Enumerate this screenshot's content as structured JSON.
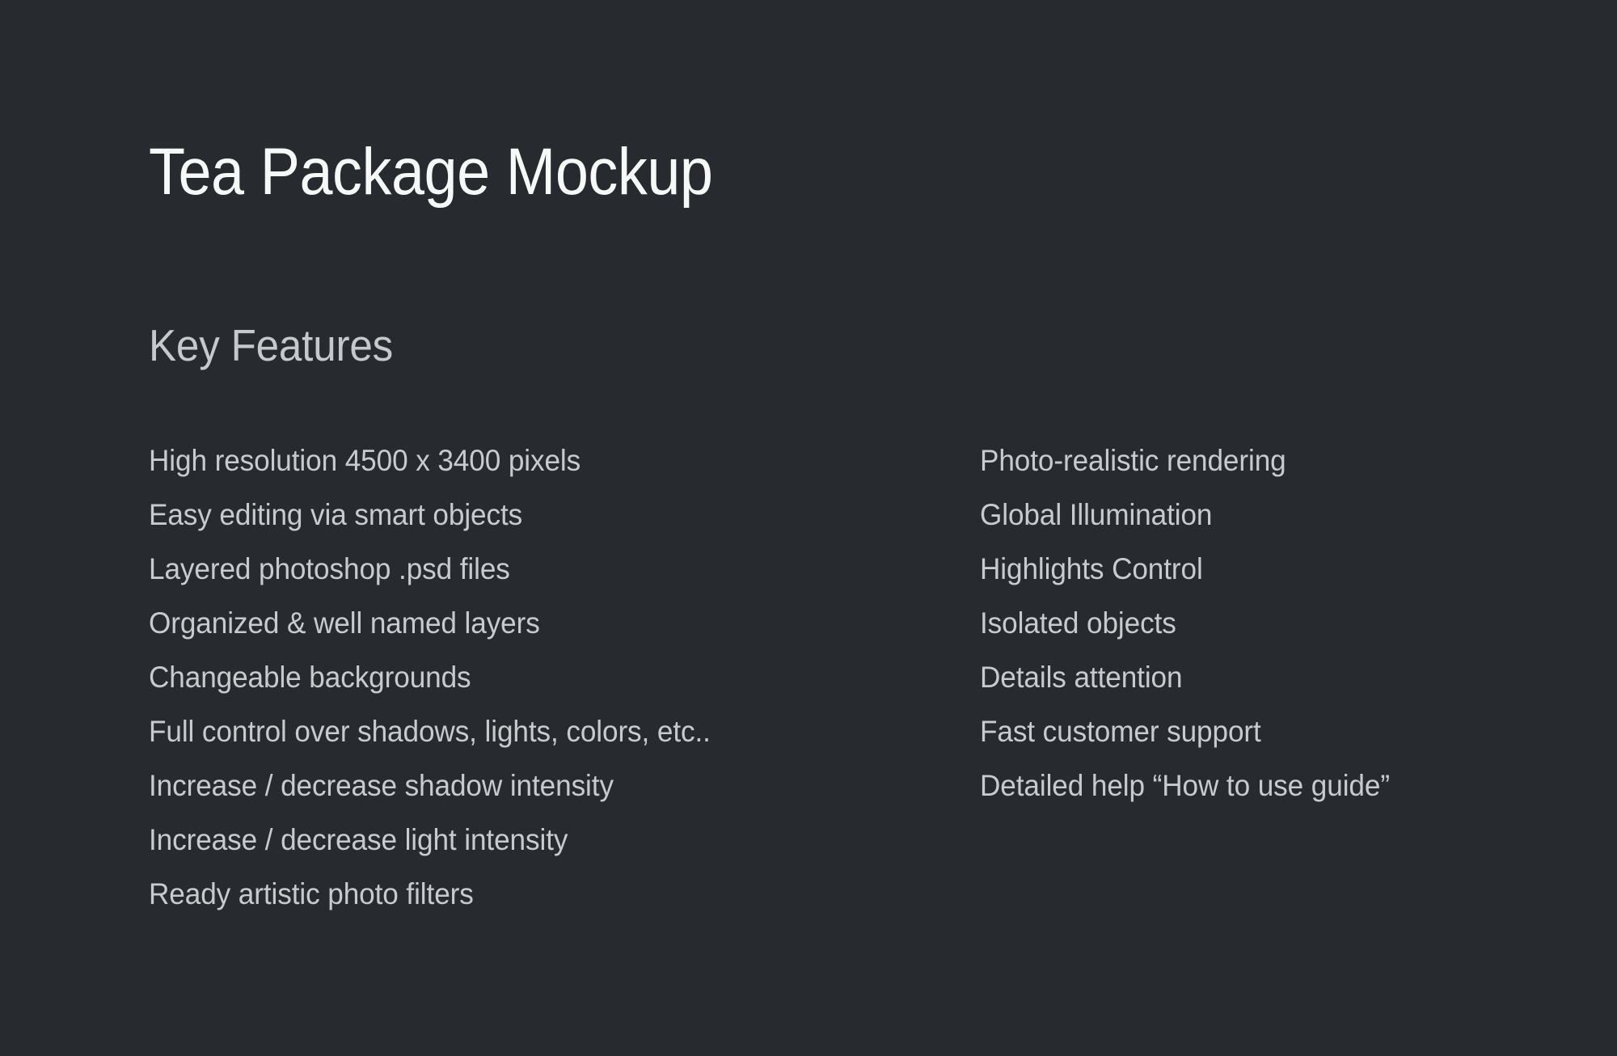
{
  "theme": {
    "background_color": "#272A2E",
    "title_color": "#F7F8F8",
    "heading_color": "#C6C9CB",
    "body_color": "#C8CBCD"
  },
  "page_title": "Tea Package Mockup",
  "section": {
    "heading": "Key Features"
  },
  "features": {
    "left_column": [
      {
        "label": "High resolution 4500 x 3400 pixels"
      },
      {
        "label": "Easy editing via smart objects"
      },
      {
        "label": "Layered photoshop .psd files"
      },
      {
        "label": "Organized & well named layers"
      },
      {
        "label": "Changeable backgrounds"
      },
      {
        "label": "Full control over shadows, lights, colors, etc.."
      },
      {
        "label": "Increase / decrease shadow intensity"
      },
      {
        "label": "Increase / decrease light intensity"
      },
      {
        "label": "Ready artistic photo filters"
      }
    ],
    "right_column": [
      {
        "label": "Photo-realistic rendering"
      },
      {
        "label": "Global Illumination"
      },
      {
        "label": "Highlights Control"
      },
      {
        "label": "Isolated objects"
      },
      {
        "label": "Details attention"
      },
      {
        "label": "Fast customer support"
      },
      {
        "label": "Detailed help “How to use guide”"
      }
    ]
  }
}
